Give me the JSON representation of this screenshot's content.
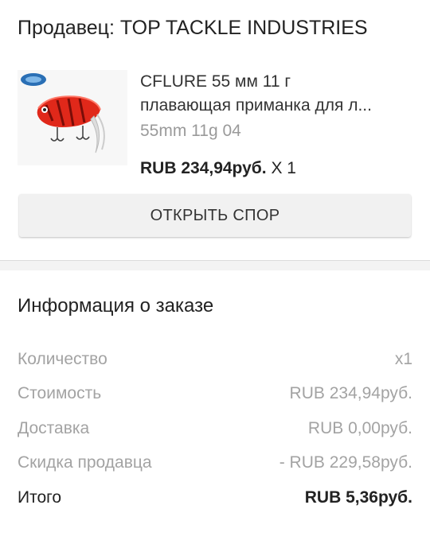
{
  "seller": {
    "label": "Продавец: TOP TACKLE INDUSTRIES"
  },
  "product": {
    "title_line1": "CFLURE 55 мм 11 г",
    "title_line2": "плавающая приманка для л...",
    "variant": "55mm 11g 04",
    "price": "RUB 234,94руб.",
    "quantity": "X 1",
    "thumbnail_icon": "fishing-lure-image"
  },
  "dispute_button": {
    "label": "ОТКРЫТЬ СПОР"
  },
  "order_info": {
    "title": "Информация о заказе",
    "rows": [
      {
        "label": "Количество",
        "value": "x1"
      },
      {
        "label": "Стоимость",
        "value": "RUB 234,94руб."
      },
      {
        "label": "Доставка",
        "value": "RUB 0,00руб."
      },
      {
        "label": "Скидка продавца",
        "value": "- RUB 229,58руб."
      }
    ],
    "total": {
      "label": "Итого",
      "value": "RUB 5,36руб."
    }
  }
}
